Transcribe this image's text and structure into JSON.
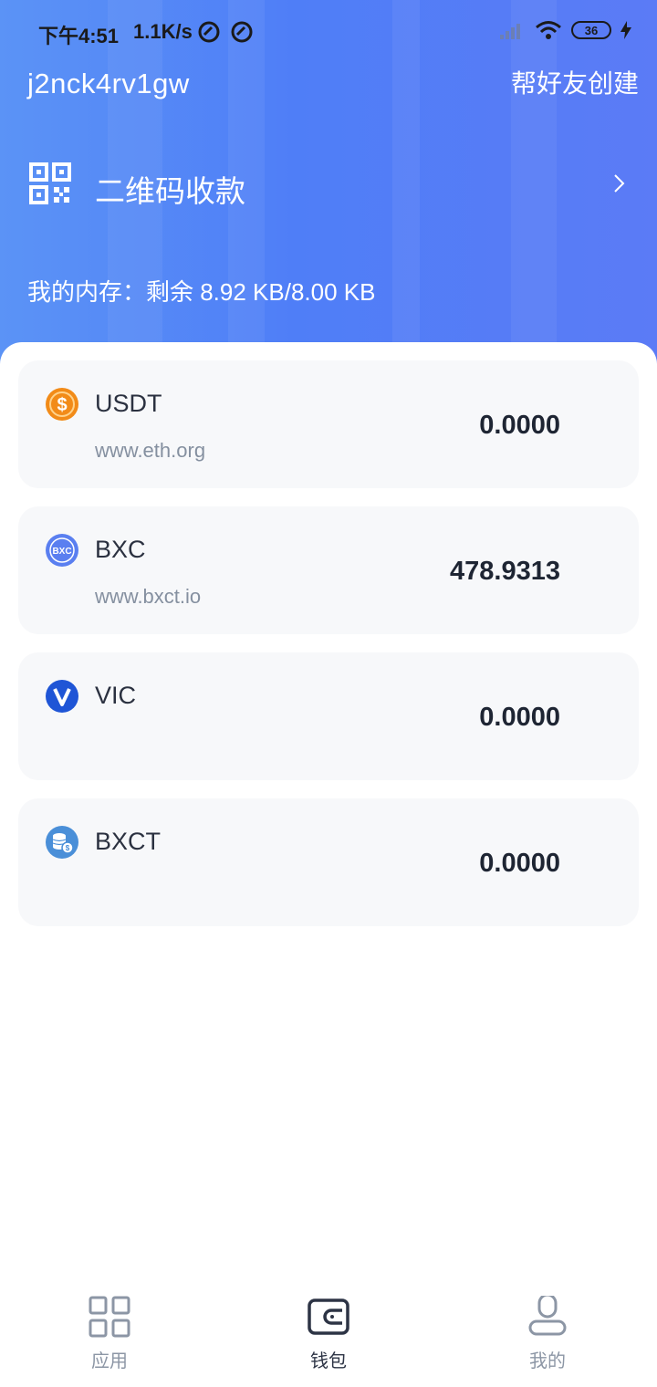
{
  "status_bar": {
    "time": "下午4:51",
    "speed": "1.1K/s",
    "battery": "36"
  },
  "header": {
    "username": "j2nck4rv1gw",
    "create_link": "帮好友创建",
    "qr_label": "二维码收款",
    "memory": "我的内存：剩余 8.92 KB/8.00 KB"
  },
  "coins": [
    {
      "name": "USDT",
      "site": "www.eth.org",
      "amount": "0.0000",
      "icon": "dollar-coin-icon",
      "color": "#f28b18"
    },
    {
      "name": "BXC",
      "site": "www.bxct.io",
      "amount": "478.9313",
      "icon": "bxc-logo-icon",
      "color": "#5a7ff0"
    },
    {
      "name": "VIC",
      "site": "",
      "amount": "0.0000",
      "icon": "vic-logo-icon",
      "color": "#1f55d6"
    },
    {
      "name": "BXCT",
      "site": "",
      "amount": "0.0000",
      "icon": "coin-stack-icon",
      "color": "#4a8fd8"
    }
  ],
  "tabs": [
    {
      "label": "应用",
      "icon": "apps-grid-icon"
    },
    {
      "label": "钱包",
      "icon": "wallet-icon",
      "active": true
    },
    {
      "label": "我的",
      "icon": "profile-icon"
    }
  ],
  "colors": {
    "header_gradient_start": "#5b93f6",
    "header_gradient_end": "#5b7bf6",
    "card_bg": "#f7f8fa",
    "amount_text": "#1e2533"
  }
}
